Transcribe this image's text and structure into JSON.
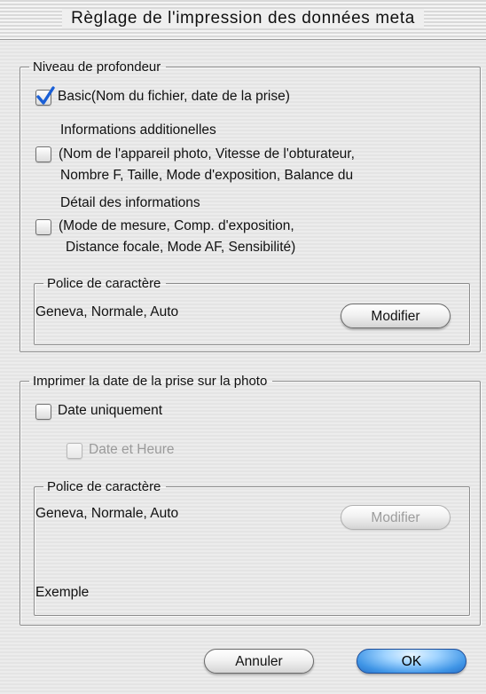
{
  "window": {
    "title": "Règlage de l'impression des données meta"
  },
  "depth_group": {
    "legend": "Niveau de profondeur",
    "basic": {
      "label": "Basic(Nom du fichier, date de la prise)",
      "checked": true
    },
    "additional": {
      "title": "Informations additionelles",
      "line1": "(Nom de l'appareil photo, Vitesse de  l'obturateur,",
      "line2": "Nombre F, Taille, Mode d'exposition, Balance du",
      "checked": false
    },
    "details": {
      "title": "Détail des informations",
      "line1": "(Mode de mesure, Comp. d'exposition,",
      "line2": "Distance focale, Mode AF, Sensibilité)",
      "checked": false
    },
    "font": {
      "legend": "Police de caractère",
      "value": "Geneva, Normale, Auto",
      "button": "Modifier"
    }
  },
  "date_group": {
    "legend": "Imprimer la date de la prise sur la photo",
    "date_only": {
      "label": "Date uniquement",
      "checked": false
    },
    "date_time": {
      "label": "Date et Heure",
      "checked": false,
      "enabled": false
    },
    "font": {
      "legend": "Police de caractère",
      "value": "Geneva, Normale, Auto",
      "button": "Modifier",
      "example_label": "Exemple"
    }
  },
  "footer": {
    "cancel": "Annuler",
    "ok": "OK"
  },
  "colors": {
    "accent": "#3f95e6",
    "disabled_text": "#9a9a9a",
    "check_mark": "#1a5fd6"
  }
}
